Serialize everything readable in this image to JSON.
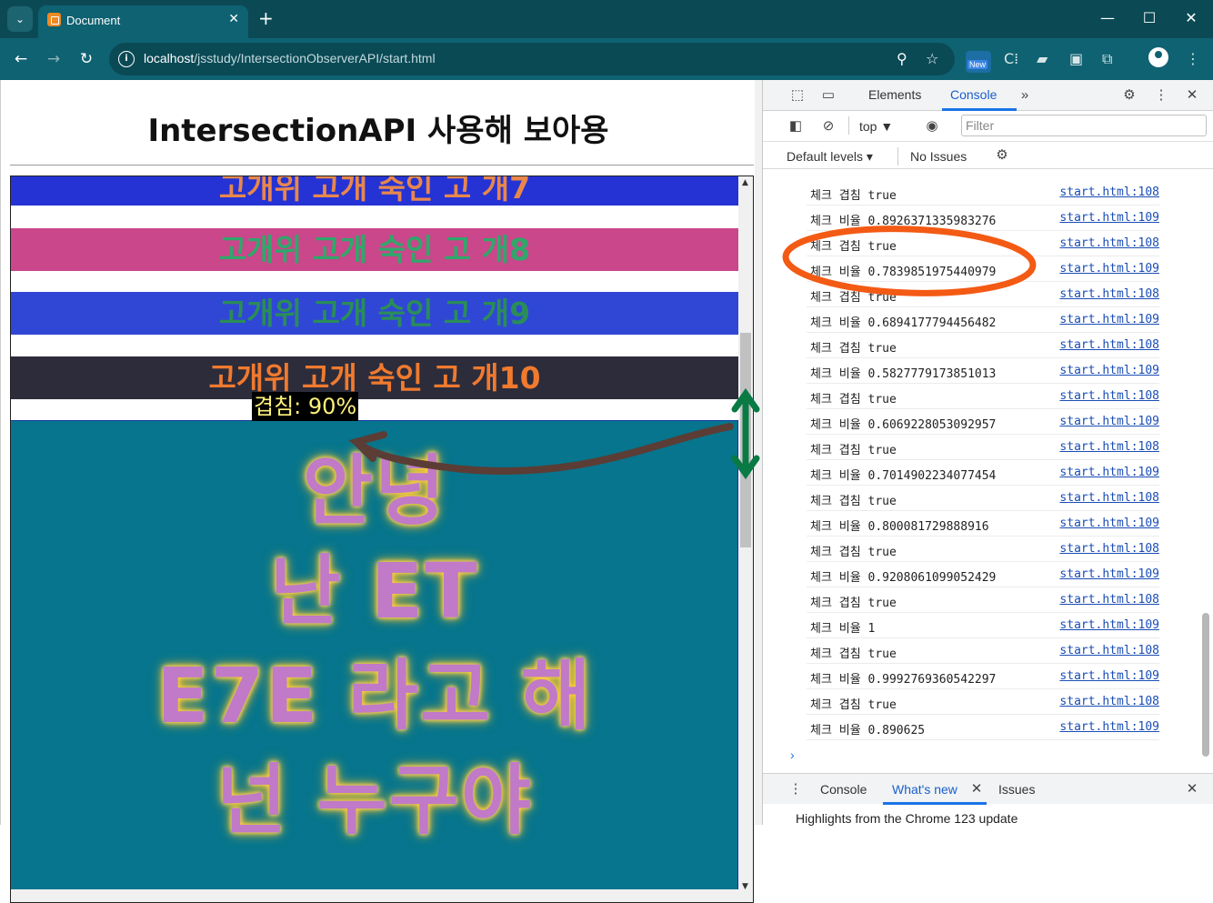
{
  "browser": {
    "tab_title": "Document",
    "url_host": "localhost",
    "url_path": "/jsstudy/IntersectionObserverAPI/start.html",
    "new_badge": "New",
    "colors": {
      "chrome_dark": "#0b4a55",
      "chrome": "#0f6272"
    }
  },
  "page": {
    "title": "IntersectionAPI 사용해 보아용",
    "boxes": [
      "고개위 고개 숙인 고 개7",
      "고개위 고개 숙인 고 개8",
      "고개위 고개 숙인 고 개9",
      "고개위 고개 숙인 고 개10"
    ],
    "ratio_label": "겹침: 90%",
    "target_lines": [
      "안녕",
      "난 ET",
      "E7E 라고 해",
      "넌 누구야"
    ]
  },
  "devtools": {
    "tabs": [
      "Elements",
      "Console"
    ],
    "active_tab": "Console",
    "context": "top",
    "filter_placeholder": "Filter",
    "levels": "Default levels",
    "issues": "No Issues",
    "logs": [
      {
        "msg": "체크 겹침 true",
        "src": "start.html:108"
      },
      {
        "msg": "체크 비율 0.8926371335983276",
        "src": "start.html:109"
      },
      {
        "msg": "체크 겹침 true",
        "src": "start.html:108"
      },
      {
        "msg": "체크 비율 0.7839851975440979",
        "src": "start.html:109"
      },
      {
        "msg": "체크 겹침 true",
        "src": "start.html:108"
      },
      {
        "msg": "체크 비율 0.6894177794456482",
        "src": "start.html:109"
      },
      {
        "msg": "체크 겹침 true",
        "src": "start.html:108"
      },
      {
        "msg": "체크 비율 0.5827779173851013",
        "src": "start.html:109"
      },
      {
        "msg": "체크 겹침 true",
        "src": "start.html:108"
      },
      {
        "msg": "체크 비율 0.6069228053092957",
        "src": "start.html:109"
      },
      {
        "msg": "체크 겹침 true",
        "src": "start.html:108"
      },
      {
        "msg": "체크 비율 0.7014902234077454",
        "src": "start.html:109"
      },
      {
        "msg": "체크 겹침 true",
        "src": "start.html:108"
      },
      {
        "msg": "체크 비율 0.800081729888916",
        "src": "start.html:109"
      },
      {
        "msg": "체크 겹침 true",
        "src": "start.html:108"
      },
      {
        "msg": "체크 비율 0.9208061099052429",
        "src": "start.html:109"
      },
      {
        "msg": "체크 겹침 true",
        "src": "start.html:108"
      },
      {
        "msg": "체크 비율 1",
        "src": "start.html:109"
      },
      {
        "msg": "체크 겹침 true",
        "src": "start.html:108"
      },
      {
        "msg": "체크 비율 0.9992769360542297",
        "src": "start.html:109"
      },
      {
        "msg": "체크 겹침 true",
        "src": "start.html:108"
      },
      {
        "msg": "체크 비율 0.890625",
        "src": "start.html:109"
      }
    ],
    "drawer_tabs": [
      "Console",
      "What's new",
      "Issues"
    ],
    "drawer_text": "Highlights from the Chrome 123 update",
    "colors": {
      "link": "#1a4db5",
      "accent": "#1a73e8"
    }
  },
  "annotation_colors": {
    "circle": "#f35a14",
    "arrow": "#5b3d35",
    "double_arrow": "#0a7a45"
  }
}
